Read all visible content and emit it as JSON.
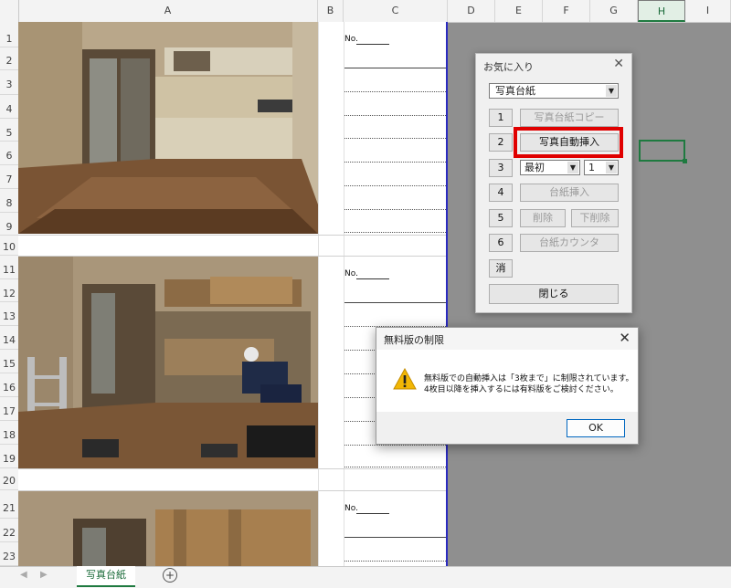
{
  "columns": [
    "A",
    "B",
    "C",
    "D",
    "E",
    "F",
    "G",
    "H",
    "I"
  ],
  "rows": [
    "1",
    "2",
    "3",
    "4",
    "5",
    "6",
    "7",
    "8",
    "9",
    "10",
    "11",
    "12",
    "13",
    "14",
    "15",
    "16",
    "17",
    "18",
    "19",
    "20",
    "21",
    "22",
    "23"
  ],
  "no_label": "No.",
  "favorites": {
    "title": "お気に入り",
    "dropdown_value": "写真台紙",
    "buttons": {
      "n1": "1",
      "n2": "2",
      "n3": "3",
      "n4": "4",
      "n5": "5",
      "n6": "6",
      "clear": "消",
      "copy_mount": "写真台紙コピー",
      "auto_insert": "写真自動挿入",
      "insert_mount": "台紙挿入",
      "delete": "削除",
      "delete_below": "下削除",
      "mount_counter": "台紙カウンタ",
      "close": "閉じる"
    },
    "position_select": "最初",
    "count_select": "1"
  },
  "dialog": {
    "title": "無料版の制限",
    "line1": "無料版での自動挿入は「3枚まで」に制限されています。",
    "line2": "4枚目以降を挿入するには有料版をご検討ください。",
    "ok": "OK"
  },
  "sheet_tab": "写真台紙",
  "colors": {
    "accent": "#1f7a40",
    "highlight": "#e00000",
    "print_edge": "#2b2bbf"
  }
}
